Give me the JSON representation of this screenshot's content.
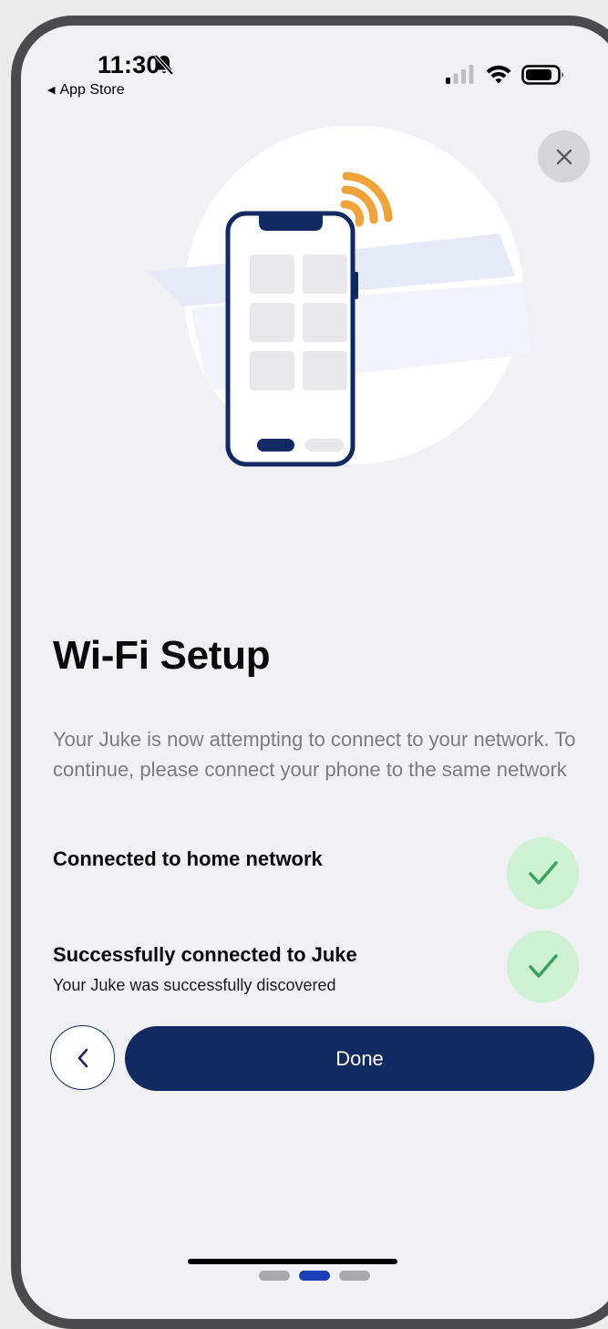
{
  "status_bar": {
    "time": "11:30",
    "back_app": "App Store",
    "icons": [
      "bell-slash-icon",
      "cellular-signal-icon",
      "wifi-icon",
      "battery-icon"
    ]
  },
  "close_button": {
    "icon": "close-icon",
    "glyph": "✕"
  },
  "illustration": {
    "icons": [
      "phone-icon",
      "wireless-signal-icon"
    ]
  },
  "title": "Wi-Fi Setup",
  "description": "Your Juke is now attempting to connect to your network. To continue, please connect your phone to the same network",
  "status_items": [
    {
      "label": "Connected to home network",
      "sub": "",
      "icon": "check-icon"
    },
    {
      "label": "Successfully connected to Juke",
      "sub": "Your Juke was successfully discovered",
      "icon": "check-icon"
    }
  ],
  "actions": {
    "back_icon": "chevron-left-icon",
    "done_label": "Done"
  },
  "pager": {
    "total": 3,
    "active_index": 1
  },
  "colors": {
    "primary": "#112a62",
    "accent_orange": "#f0a23b",
    "success_bg": "#cdf1d2",
    "success_check": "#3aa45a",
    "background": "#f1f1f5"
  }
}
